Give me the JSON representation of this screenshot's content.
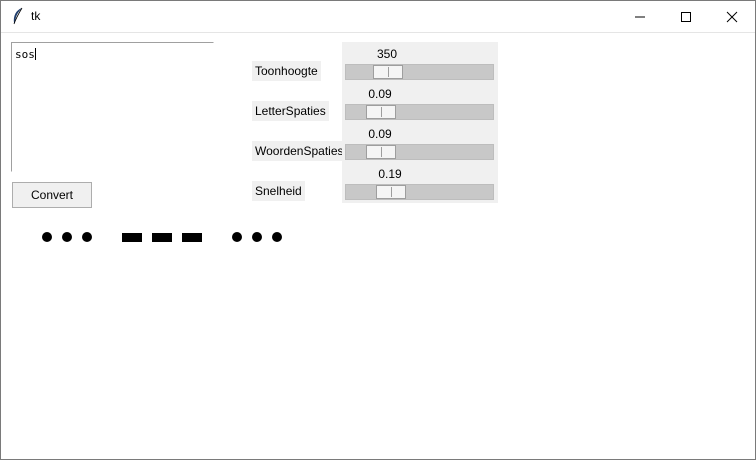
{
  "window": {
    "title": "tk",
    "icons": {
      "app": "feather-icon",
      "minimize": "minimize-icon",
      "maximize": "maximize-icon",
      "close": "close-icon"
    }
  },
  "input": {
    "text": "sos"
  },
  "convert_button": {
    "label": "Convert"
  },
  "scales": [
    {
      "label": "Toonhoogte",
      "value": "350",
      "fraction": 0.16
    },
    {
      "label": "LetterSpaties",
      "value": "0.09",
      "fraction": 0.09
    },
    {
      "label": "WoordenSpaties",
      "value": "0.09",
      "fraction": 0.09
    },
    {
      "label": "Snelheid",
      "value": "0.19",
      "fraction": 0.19
    }
  ],
  "morse_output": {
    "letters": [
      [
        "dot",
        "dot",
        "dot"
      ],
      [
        "dash",
        "dash",
        "dash"
      ],
      [
        "dot",
        "dot",
        "dot"
      ]
    ],
    "color": "#000000"
  }
}
